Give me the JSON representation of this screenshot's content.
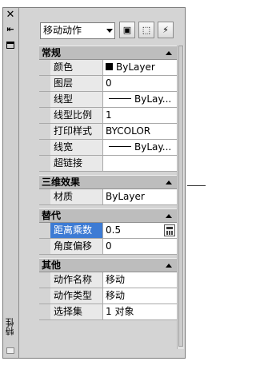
{
  "titlebar": {
    "label": "特性",
    "icons": {
      "close": "close-icon",
      "autohide": "autohide-icon",
      "properties": "properties-icon"
    }
  },
  "toolbar": {
    "selection_value": "移动动作",
    "buttons": [
      "toggle-pickadd-icon",
      "select-objects-icon",
      "quick-select-icon"
    ]
  },
  "sections": {
    "general": {
      "title": "常规",
      "rows": [
        {
          "name": "颜色",
          "value": "ByLayer"
        },
        {
          "name": "图层",
          "value": "0"
        },
        {
          "name": "线型",
          "value": "ByLay..."
        },
        {
          "name": "线型比例",
          "value": "1"
        },
        {
          "name": "打印样式",
          "value": "BYCOLOR"
        },
        {
          "name": "线宽",
          "value": "ByLay..."
        },
        {
          "name": "超链接",
          "value": ""
        }
      ]
    },
    "threed": {
      "title": "三维效果",
      "rows": [
        {
          "name": "材质",
          "value": "ByLayer"
        }
      ]
    },
    "overrides": {
      "title": "替代",
      "rows": [
        {
          "name": "距离乘数",
          "value": "0.5"
        },
        {
          "name": "角度偏移",
          "value": "0"
        }
      ]
    },
    "misc": {
      "title": "其他",
      "rows": [
        {
          "name": "动作名称",
          "value": "移动"
        },
        {
          "name": "动作类型",
          "value": "移动"
        },
        {
          "name": "选择集",
          "value": "1 对象"
        }
      ]
    }
  },
  "colors": {
    "selected_row": "#3d7bd4",
    "section_header": "#bdbdbd",
    "palette_bg": "#d4d4d4"
  }
}
